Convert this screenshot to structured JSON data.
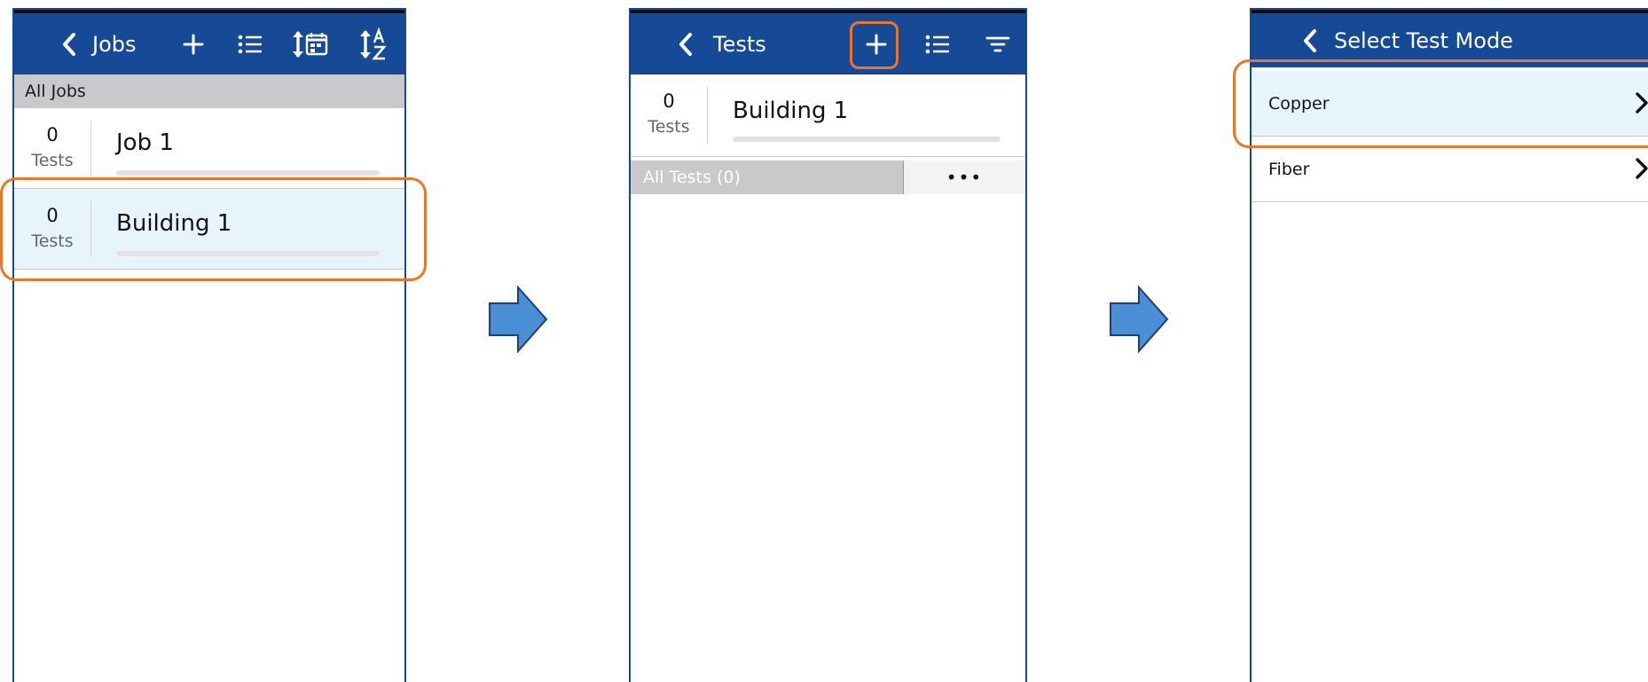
{
  "screen1": {
    "title": "Jobs",
    "icons": [
      "back-chevron-icon",
      "plus-icon",
      "list-icon",
      "sort-by-date-icon",
      "sort-alpha-icon"
    ],
    "section_label": "All Jobs",
    "rows": [
      {
        "count": "0",
        "count_label": "Tests",
        "name": "Job 1",
        "selected": false
      },
      {
        "count": "0",
        "count_label": "Tests",
        "name": "Building 1",
        "selected": true
      }
    ]
  },
  "screen2": {
    "title": "Tests",
    "icons": [
      "back-chevron-icon",
      "plus-icon",
      "list-icon",
      "filter-icon"
    ],
    "job": {
      "count": "0",
      "count_label": "Tests",
      "name": "Building 1"
    },
    "section_label": "All Tests (0)",
    "more_label": "•••"
  },
  "screen3": {
    "title": "Select Test Mode",
    "icons": [
      "back-chevron-icon"
    ],
    "modes": [
      {
        "label": "Copper",
        "selected": true
      },
      {
        "label": "Fiber",
        "selected": false
      }
    ]
  },
  "colors": {
    "header": "#164a96",
    "highlight": "#e8772e",
    "selected_row": "#e8f4fc",
    "section_bar": "#c9c9cb",
    "flow_arrow": "#4a8fd6"
  }
}
